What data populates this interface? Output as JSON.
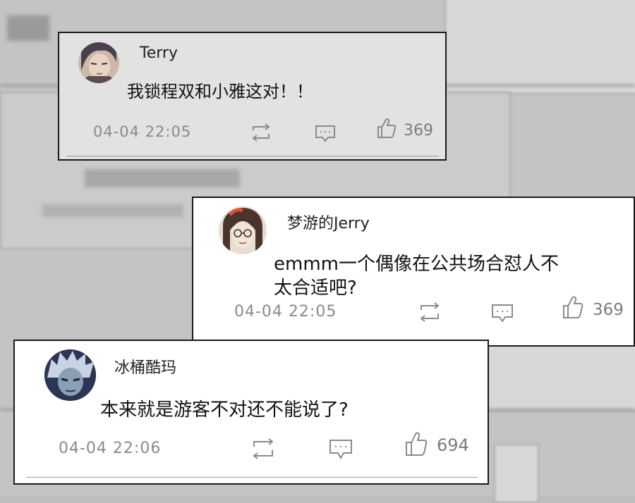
{
  "comments": [
    {
      "user": "Terry",
      "text": "我锁程双和小雅这对！！",
      "time": "04-04  22:05",
      "likes": "369",
      "avatar": "dark-haired-man-avatar"
    },
    {
      "user": "梦游的Jerry",
      "text_line1": "emmm一个偶像在公共场合怼人不",
      "text_line2": "太合适吧?",
      "time": "04-04  22:05",
      "likes": "369",
      "avatar": "girl-with-glasses-avatar"
    },
    {
      "user": "冰桶酷玛",
      "text": "本来就是游客不对还不能说了?",
      "time": "04-04  22:06",
      "likes": "694",
      "avatar": "silver-haired-boy-avatar"
    }
  ],
  "icons": {
    "repost": "repost-icon",
    "reply": "comment-icon",
    "like": "thumbs-up-icon"
  },
  "colors": {
    "card_bg": "#ffffff",
    "dim_card_bg": "#e2e2e2",
    "meta_text": "#8a8a8a",
    "border": "#1a1a1a"
  }
}
